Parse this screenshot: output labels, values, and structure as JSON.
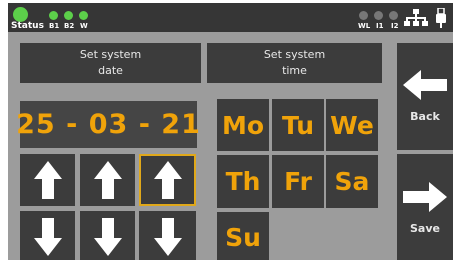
{
  "status_bar": {
    "status_label": "Status",
    "indicators": [
      "B1",
      "B2",
      "W"
    ],
    "right_labels": [
      "WL",
      "I1",
      "I2"
    ],
    "colors": {
      "on": "#5ccf4a",
      "off": "#777777"
    }
  },
  "headers": {
    "date_line1": "Set system",
    "date_line2": "date",
    "time_line1": "Set system",
    "time_line2": "time"
  },
  "date_display": {
    "value": "25 - 03 - 21"
  },
  "days": [
    "Mo",
    "Tu",
    "We",
    "Th",
    "Fr",
    "Sa",
    "Su"
  ],
  "side": {
    "back_label": "Back",
    "save_label": "Save"
  },
  "icons": {
    "up": "arrow-up-icon",
    "down": "arrow-down-icon",
    "left": "arrow-left-icon",
    "right": "arrow-right-icon",
    "network": "network-icon",
    "usb": "usb-icon"
  },
  "accent_color": "#f0a30a"
}
